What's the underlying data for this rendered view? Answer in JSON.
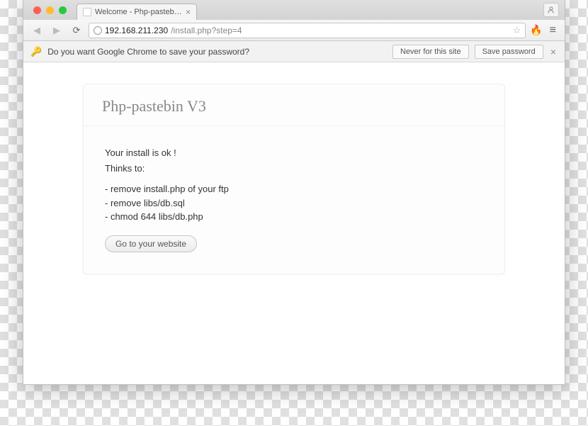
{
  "tab": {
    "title": "Welcome - Php-pastebin V"
  },
  "url": {
    "host": "192.168.211.230",
    "path": "/install.php?step=4"
  },
  "infobar": {
    "message": "Do you want Google Chrome to save your password?",
    "never": "Never for this site",
    "save": "Save password"
  },
  "page": {
    "title": "Php-pastebin V3",
    "line1": "Your install is ok !",
    "line2": "Thinks to:",
    "items": [
      "remove install.php of your ftp",
      "remove libs/db.sql",
      "chmod 644 libs/db.php"
    ],
    "goto": "Go to your website"
  }
}
